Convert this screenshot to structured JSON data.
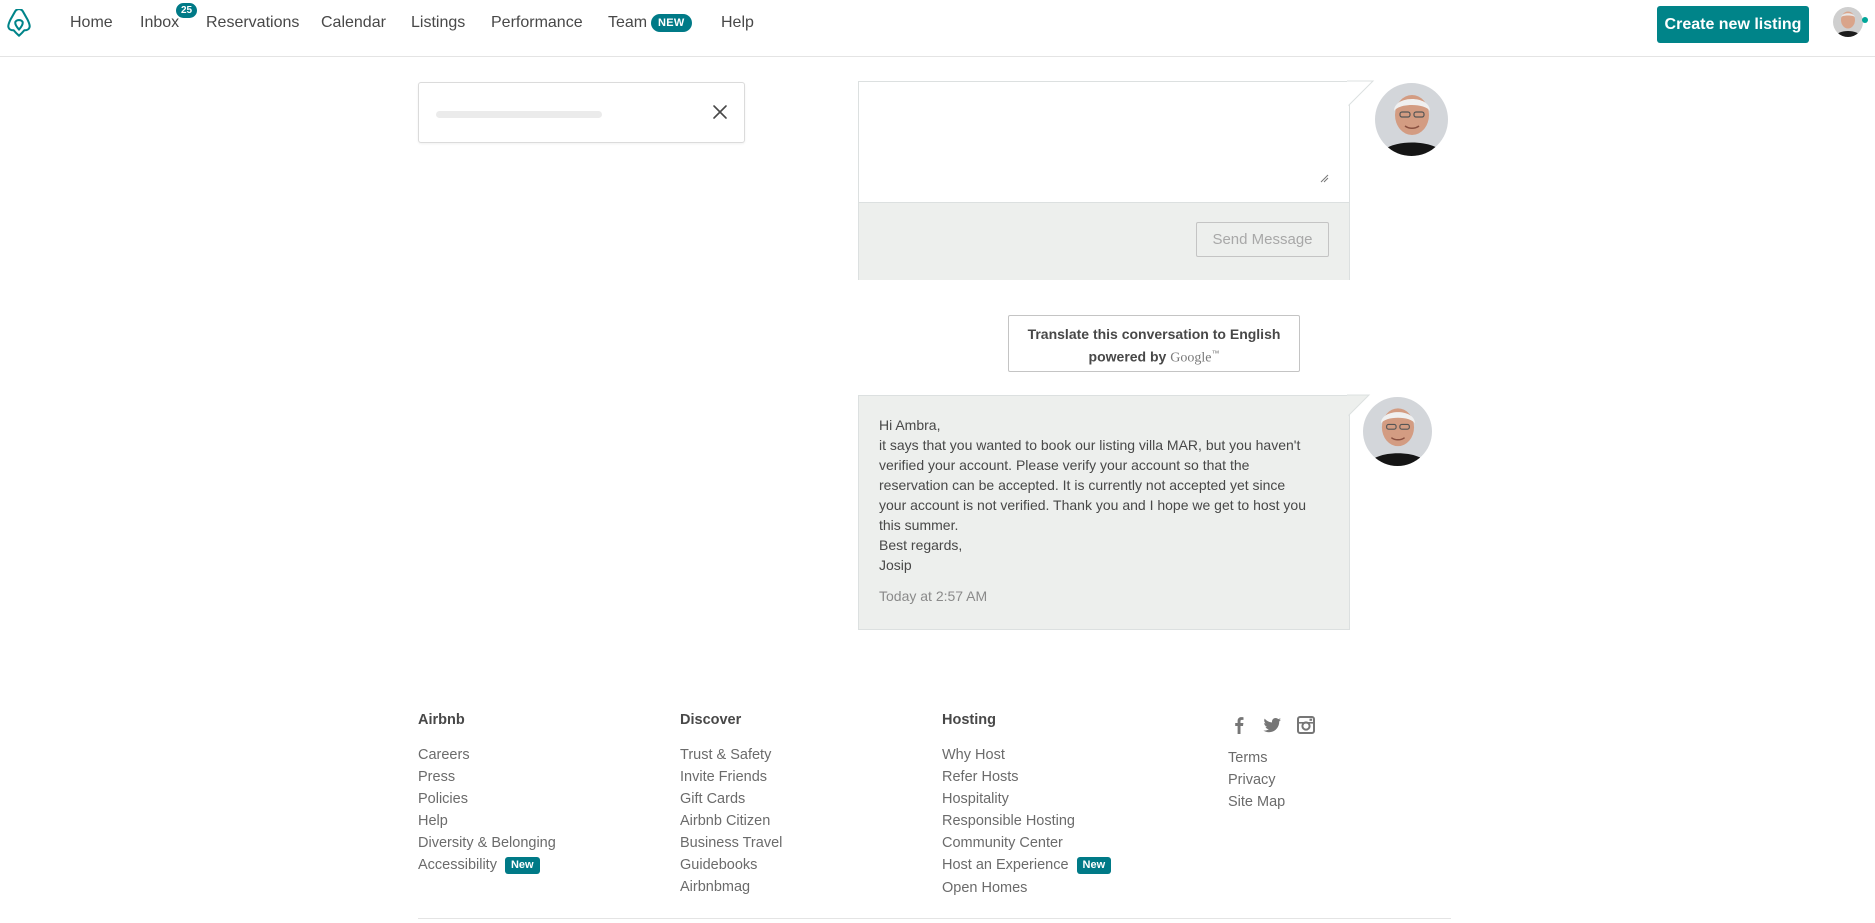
{
  "nav": {
    "items": [
      {
        "label": "Home"
      },
      {
        "label": "Inbox"
      },
      {
        "label": "Reservations"
      },
      {
        "label": "Calendar"
      },
      {
        "label": "Listings"
      },
      {
        "label": "Performance"
      },
      {
        "label": "Team"
      },
      {
        "label": "Help"
      }
    ],
    "inbox_count": "25",
    "team_badge": "NEW",
    "create_button": "Create new listing"
  },
  "search": {
    "value": "",
    "placeholder": ""
  },
  "composer": {
    "value": "",
    "placeholder": "",
    "send_label": "Send Message"
  },
  "translate": {
    "line1": "Translate this conversation to English",
    "powered_by": "powered by",
    "google": "Google",
    "tm": "™"
  },
  "message": {
    "lines": [
      "Hi Ambra,",
      "it says that you wanted to book our listing villa MAR, but you haven't",
      "verified your account. Please verify your account so that the",
      "reservation can be accepted. It is currently not accepted yet since",
      "your account is not verified. Thank you and I hope we get to host you",
      "this summer.",
      "Best regards,",
      "Josip"
    ],
    "timestamp": "Today at 2:57 AM"
  },
  "footer": {
    "airbnb": {
      "heading": "Airbnb",
      "links": [
        "Careers",
        "Press",
        "Policies",
        "Help",
        "Diversity & Belonging",
        "Accessibility"
      ],
      "accessibility_badge": "New"
    },
    "discover": {
      "heading": "Discover",
      "links": [
        "Trust & Safety",
        "Invite Friends",
        "Gift Cards",
        "Airbnb Citizen",
        "Business Travel",
        "Guidebooks",
        "Airbnbmag"
      ]
    },
    "hosting": {
      "heading": "Hosting",
      "links": [
        "Why Host",
        "Refer Hosts",
        "Hospitality",
        "Responsible Hosting",
        "Community Center",
        "Host an Experience",
        "Open Homes"
      ],
      "experience_badge": "New"
    },
    "legal": {
      "links": [
        "Terms",
        "Privacy",
        "Site Map"
      ]
    }
  },
  "colors": {
    "brand": "#FF5A5F",
    "accent": "#008489",
    "badge": "#007A87",
    "text": "#484848"
  },
  "icons": [
    "airbnb-logo-icon",
    "close-icon",
    "facebook-icon",
    "twitter-icon",
    "instagram-icon"
  ]
}
